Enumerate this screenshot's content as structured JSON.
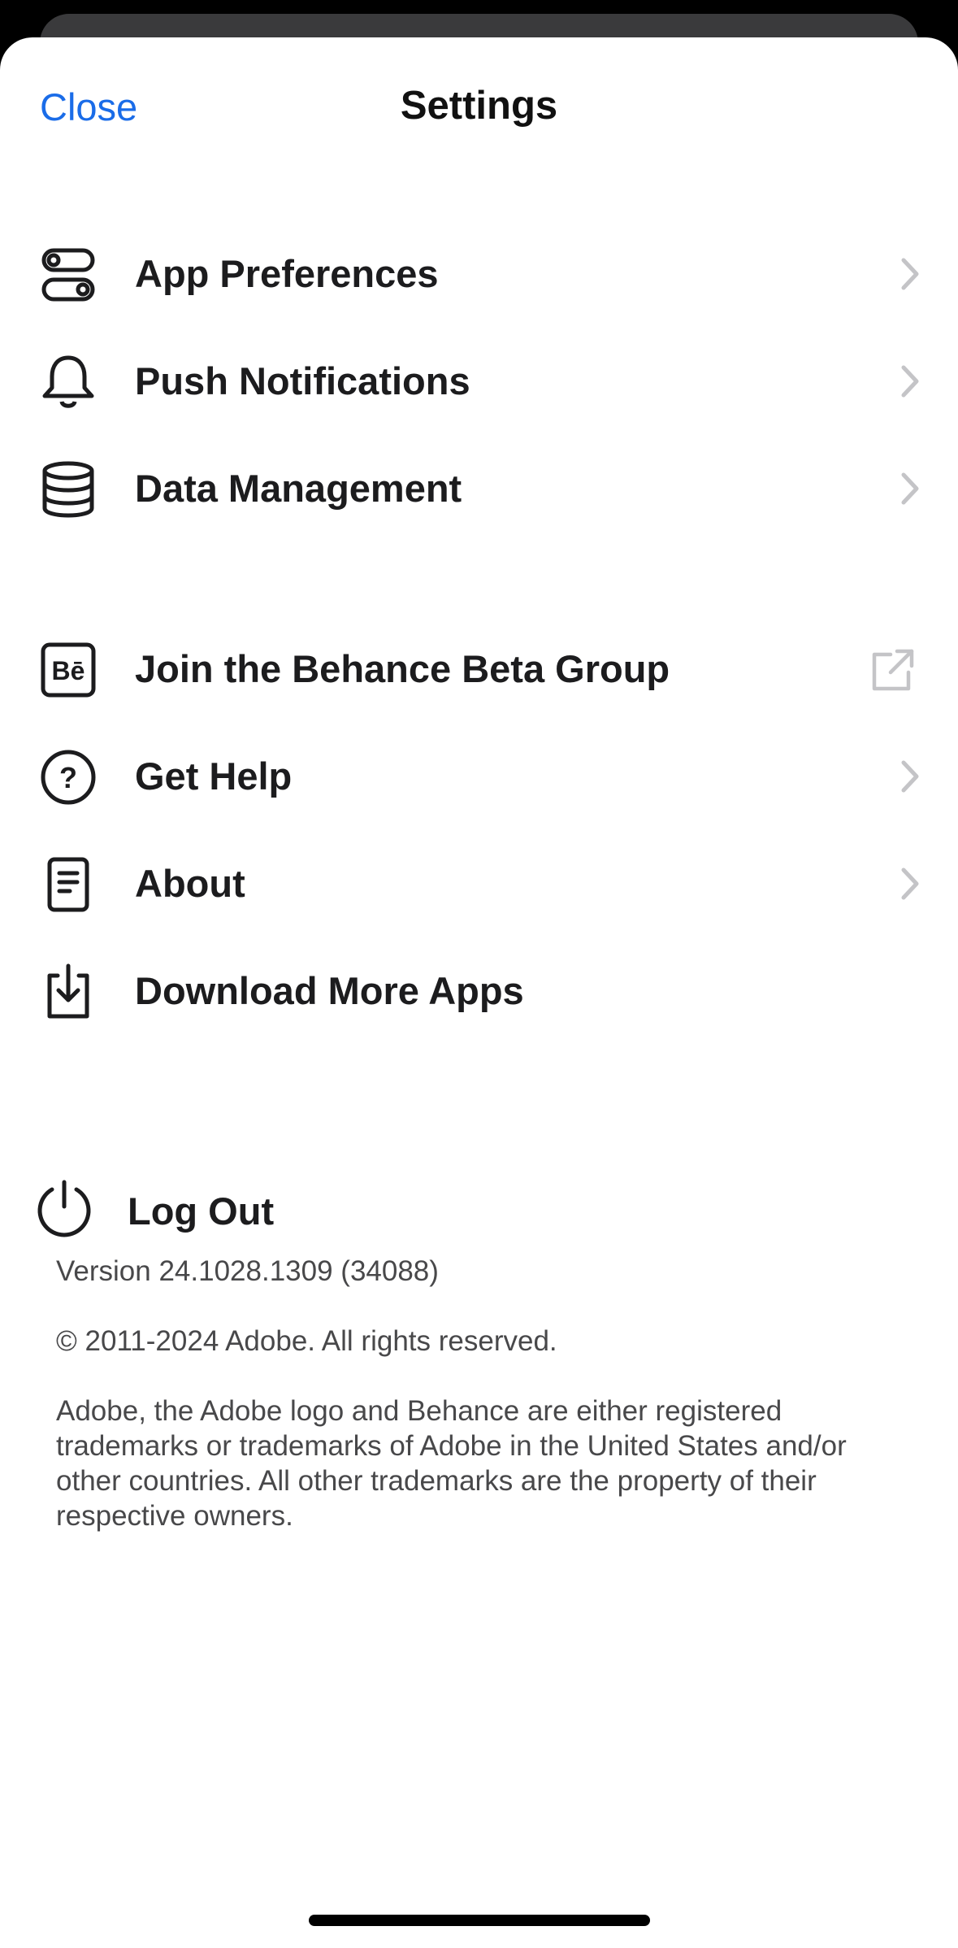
{
  "nav": {
    "close_label": "Close",
    "title": "Settings"
  },
  "section1": [
    {
      "label": "App Preferences",
      "icon": "toggles-icon",
      "accessory": "chevron"
    },
    {
      "label": "Push Notifications",
      "icon": "bell-icon",
      "accessory": "chevron"
    },
    {
      "label": "Data Management",
      "icon": "database-icon",
      "accessory": "chevron"
    }
  ],
  "section2": [
    {
      "label": "Join the Behance Beta Group",
      "icon": "behance-icon",
      "badge": "Bē",
      "accessory": "external-link"
    },
    {
      "label": "Get Help",
      "icon": "question-circle-icon",
      "badge": "?",
      "accessory": "chevron"
    },
    {
      "label": "About",
      "icon": "document-icon",
      "accessory": "chevron"
    },
    {
      "label": "Download More Apps",
      "icon": "download-icon",
      "accessory": "none"
    }
  ],
  "logout": {
    "label": "Log Out",
    "icon": "power-icon"
  },
  "footer": {
    "version": "Version 24.1028.1309 (34088)",
    "copyright": "© 2011-2024 Adobe. All rights reserved.",
    "trademark": "Adobe, the Adobe logo and Behance are either registered trademarks or trademarks of Adobe in the United States and/or other countries. All other trademarks are the property of their respective owners."
  },
  "colors": {
    "accent": "#1a6ce8",
    "text": "#1c1c1e",
    "chevron": "#c4c4c7",
    "background": "#ffffff"
  }
}
